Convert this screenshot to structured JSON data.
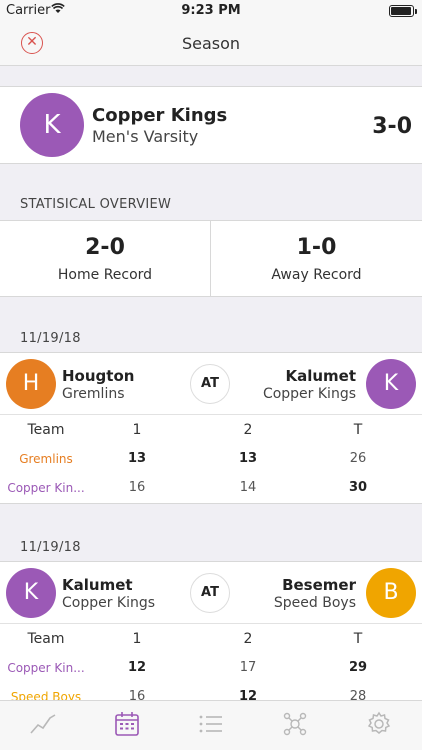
{
  "status_bar": {
    "carrier": "Carrier",
    "time": "9:23 PM",
    "battery_level": 0.95
  },
  "nav": {
    "title": "Season"
  },
  "team": {
    "initial": "K",
    "name": "Copper Kings",
    "subtitle": "Men's Varsity",
    "record": "3-0"
  },
  "overview": {
    "header": "STATISICAL OVERVIEW",
    "home": {
      "value": "2-0",
      "label": "Home Record"
    },
    "away": {
      "value": "1-0",
      "label": "Away Record"
    }
  },
  "colors": {
    "purple": "#9b59b6",
    "orange": "#e67e22",
    "gold": "#f0a500",
    "close_red": "#d9534f"
  },
  "games": [
    {
      "date": "11/19/18",
      "left": {
        "initial": "H",
        "name": "Hougton",
        "sub": "Gremlins",
        "color": "#e67e22"
      },
      "at": "AT",
      "right": {
        "initial": "K",
        "name": "Kalumet",
        "sub": "Copper Kings",
        "color": "#9b59b6"
      },
      "headers": {
        "team": "Team",
        "p1": "1",
        "p2": "2",
        "total": "T"
      },
      "rows": [
        {
          "team": "Gremlins",
          "p1": "13",
          "p2": "13",
          "total": "26"
        },
        {
          "team": "Copper Kin...",
          "p1": "16",
          "p2": "14",
          "total": "30"
        }
      ]
    },
    {
      "date": "11/19/18",
      "left": {
        "initial": "K",
        "name": "Kalumet",
        "sub": "Copper Kings",
        "color": "#9b59b6"
      },
      "at": "AT",
      "right": {
        "initial": "B",
        "name": "Besemer",
        "sub": "Speed Boys",
        "color": "#f0a500"
      },
      "headers": {
        "team": "Team",
        "p1": "1",
        "p2": "2",
        "total": "T"
      },
      "rows": [
        {
          "team": "Copper Kin...",
          "p1": "12",
          "p2": "17",
          "total": "29"
        },
        {
          "team": "Speed Boys",
          "p1": "16",
          "p2": "12",
          "total": "28"
        }
      ]
    }
  ],
  "tabs": [
    {
      "icon": "chart-line-icon"
    },
    {
      "icon": "calendar-icon",
      "active": true
    },
    {
      "icon": "list-icon"
    },
    {
      "icon": "network-icon"
    },
    {
      "icon": "gear-icon"
    }
  ]
}
